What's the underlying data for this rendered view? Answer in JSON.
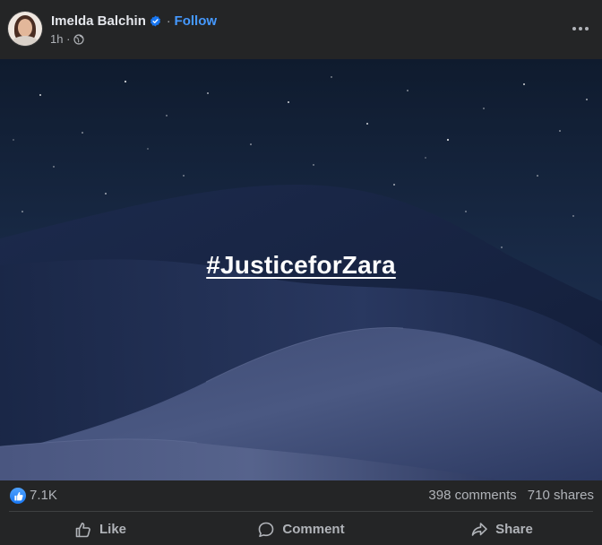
{
  "post": {
    "author_name": "Imelda Balchin",
    "separator": "·",
    "follow_label": "Follow",
    "timestamp": "1h ·",
    "hashtag": "#JusticeforZara",
    "reaction_count": "7.1K",
    "comments": "398 comments",
    "shares": "710 shares"
  },
  "actions": {
    "like": "Like",
    "comment": "Comment",
    "share": "Share"
  },
  "colors": {
    "background": "#242526",
    "follow_accent": "#4599ff",
    "like_blue": "#1877f2",
    "secondary_text": "#b0b3b8"
  },
  "icons": {
    "verified": "verified-badge-icon",
    "privacy": "globe-icon",
    "more": "more-options-icon",
    "like_reaction": "thumbs-up-icon",
    "like_action": "thumbs-up-outline-icon",
    "comment_action": "speech-bubble-icon",
    "share_action": "share-arrow-icon"
  }
}
